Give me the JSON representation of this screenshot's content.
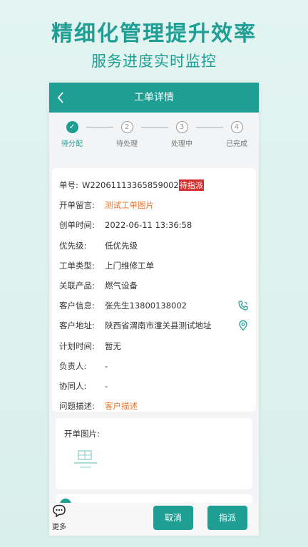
{
  "promo": {
    "title": "精细化管理提升效率",
    "subtitle": "服务进度实时监控"
  },
  "appbar": {
    "back_icon": "chevron-left-icon",
    "title": "工单详情"
  },
  "steps": [
    {
      "num": "✓",
      "label": "待分配",
      "done": true
    },
    {
      "num": "2",
      "label": "待处理",
      "done": false
    },
    {
      "num": "3",
      "label": "处理中",
      "done": false
    },
    {
      "num": "4",
      "label": "已完成",
      "done": false
    }
  ],
  "order": {
    "number_label": "单号:",
    "number_value": "W22061113365859002",
    "status_badge": "待指派",
    "fields": [
      {
        "key": "开单留言:",
        "value": "测试工单图片"
      },
      {
        "key": "创单时间:",
        "value": "2022-06-11 13:36:58"
      },
      {
        "key": "优先级:",
        "value": "低优先级"
      },
      {
        "key": "工单类型:",
        "value": "上门维修工单"
      },
      {
        "key": "关联产品:",
        "value": "燃气设备"
      },
      {
        "key": "客户信息:",
        "value": "张先生13800138002"
      },
      {
        "key": "客户地址:",
        "value": "陕西省渭南市潼关县测试地址"
      },
      {
        "key": "计划时间:",
        "value": "暂无"
      },
      {
        "key": "负责人:",
        "value": "-"
      },
      {
        "key": "协同人:",
        "value": "-"
      },
      {
        "key": "问题描述:",
        "value": "客户描述"
      }
    ]
  },
  "images": {
    "label": "开单图片:"
  },
  "bottom": {
    "more_label": "更多",
    "cancel_label": "取消",
    "assign_label": "指派"
  },
  "colors": {
    "accent": "#1f9e94",
    "orange": "#e8752a",
    "badge": "#d32f2f"
  }
}
